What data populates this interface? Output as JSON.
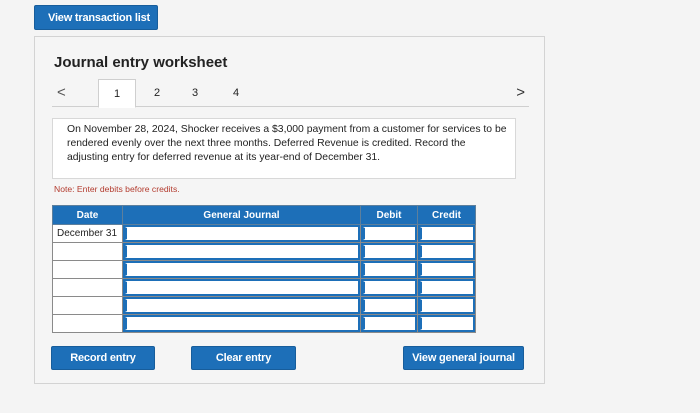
{
  "top_button": {
    "label": "View transaction list"
  },
  "worksheet": {
    "title": "Journal entry worksheet",
    "tabs": [
      "1",
      "2",
      "3",
      "4"
    ],
    "active_tab": "1",
    "nav_prev": "<",
    "nav_next": ">"
  },
  "prompt": {
    "text": "On November 28, 2024, Shocker receives a $3,000 payment from a customer for services to be rendered evenly over the next three months. Deferred Revenue is credited. Record the adjusting entry for deferred revenue at its year-end of December 31."
  },
  "note": "Note: Enter debits before credits.",
  "table": {
    "headers": {
      "date": "Date",
      "general_journal": "General Journal",
      "debit": "Debit",
      "credit": "Credit"
    },
    "rows": [
      {
        "date": "December 31"
      },
      {
        "date": ""
      },
      {
        "date": ""
      },
      {
        "date": ""
      },
      {
        "date": ""
      },
      {
        "date": ""
      }
    ]
  },
  "buttons": {
    "record": "Record entry",
    "clear": "Clear entry",
    "view_journal": "View general journal"
  },
  "colors": {
    "accent": "#1d6fb8",
    "note": "#b33b2e"
  }
}
